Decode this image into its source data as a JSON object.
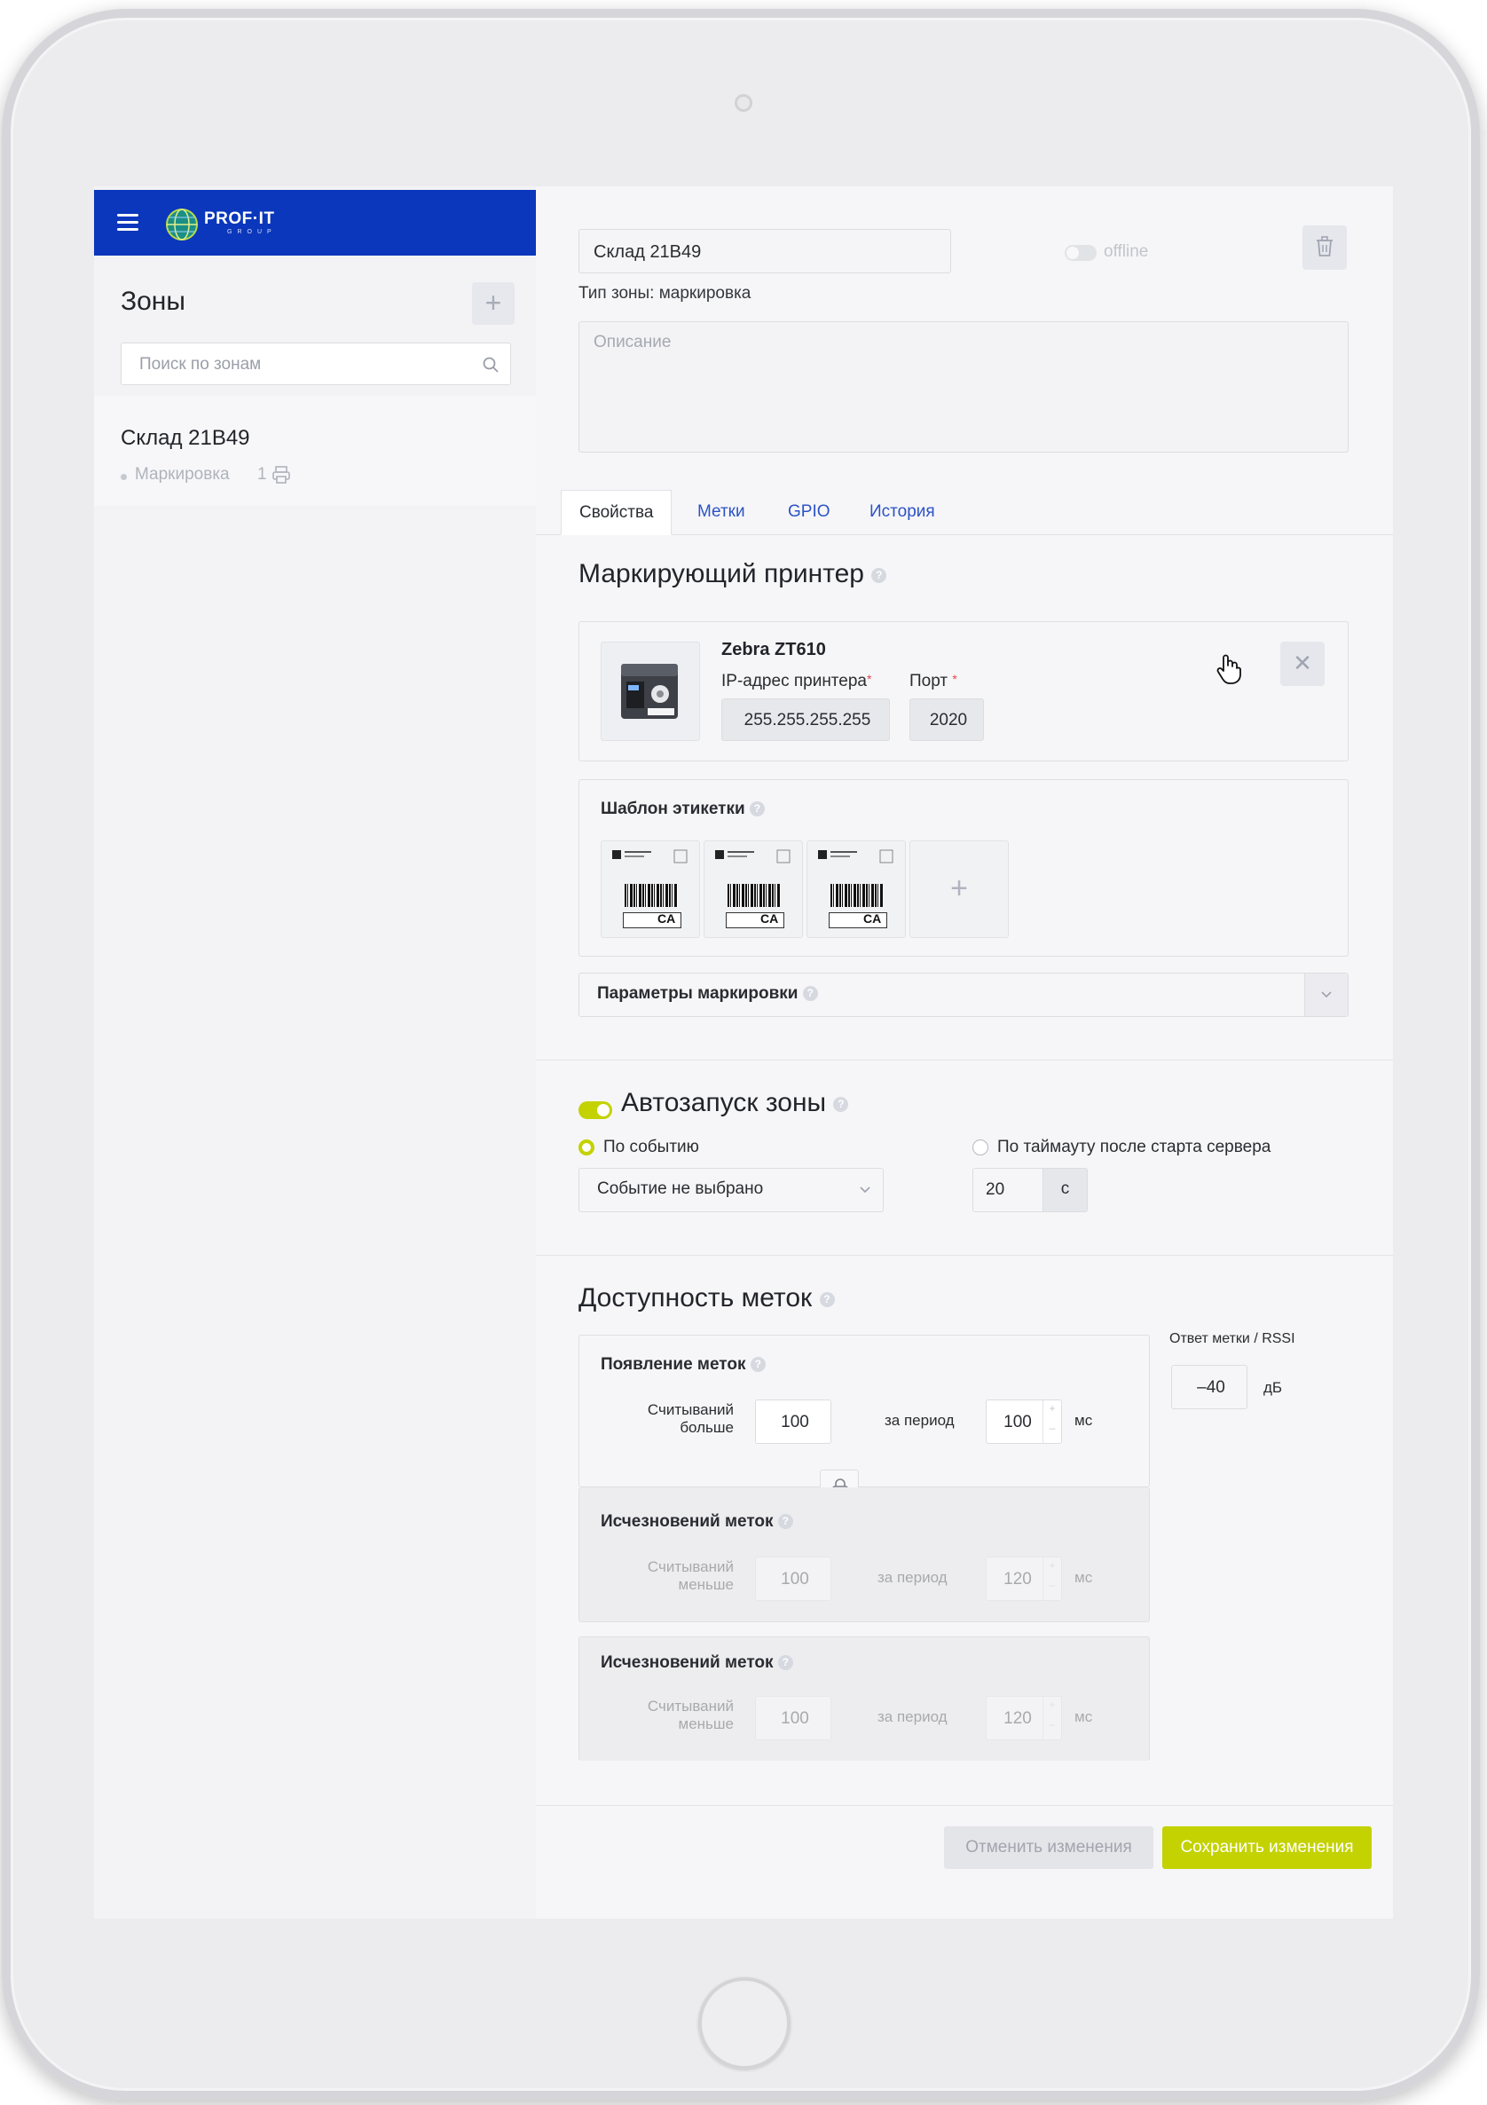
{
  "colors": {
    "brand_blue": "#0a37bb",
    "accent_green": "#c3d200",
    "link_blue": "#2c53c5",
    "required_red": "#e0464d"
  },
  "header": {
    "brand_name": "PROF·IT",
    "brand_sub": "GROUP"
  },
  "sidebar": {
    "title": "Зоны",
    "search_placeholder": "Поиск по зонам",
    "zones": [
      {
        "name": "Склад 21B49",
        "type": "Маркировка",
        "printers_count": "1"
      }
    ]
  },
  "zone": {
    "name": "Склад 21B49",
    "status_label": "offline",
    "type_text": "Тип зоны: маркировка",
    "description_placeholder": "Описание"
  },
  "tabs": [
    {
      "label": "Свойства",
      "active": true
    },
    {
      "label": "Метки",
      "active": false
    },
    {
      "label": "GPIO",
      "active": false
    },
    {
      "label": "История",
      "active": false
    }
  ],
  "printer_section": {
    "title": "Маркирующий принтер",
    "printer_name": "Zebra ZT610",
    "ip_label": "IP-адрес принтера",
    "ip_value": "255.255.255.255",
    "port_label": "Порт",
    "port_value": "2020",
    "required_mark": "*"
  },
  "label_template": {
    "title": "Шаблон этикетки",
    "templates": [
      {
        "code": "CA"
      },
      {
        "code": "CA"
      },
      {
        "code": "CA"
      }
    ],
    "add_label": "+"
  },
  "marking_params": {
    "label": "Параметры маркировки"
  },
  "autostart": {
    "title": "Автозапуск зоны",
    "enabled": true,
    "option_event": "По событию",
    "option_timeout": "По таймауту после старта сервера",
    "event_select_value": "Событие не выбрано",
    "timeout_value": "20",
    "timeout_unit": "с"
  },
  "availability": {
    "title": "Доступность меток",
    "appearance": {
      "title": "Появление меток",
      "reads_label_line1": "Считываний",
      "reads_label_line2": "больше",
      "reads_value": "100",
      "period_label": "за период",
      "period_value": "100",
      "unit": "мс"
    },
    "disappearance": {
      "title": "Исчезновений меток",
      "reads_label_line1": "Считываний",
      "reads_label_line2": "меньше",
      "reads_value": "100",
      "period_label": "за период",
      "period_value": "120",
      "unit": "мс"
    },
    "rssi": {
      "label": "Ответ метки / RSSI",
      "value": "–40",
      "unit": "дБ"
    }
  },
  "footer": {
    "cancel_label": "Отменить изменения",
    "save_label": "Сохранить изменения"
  }
}
